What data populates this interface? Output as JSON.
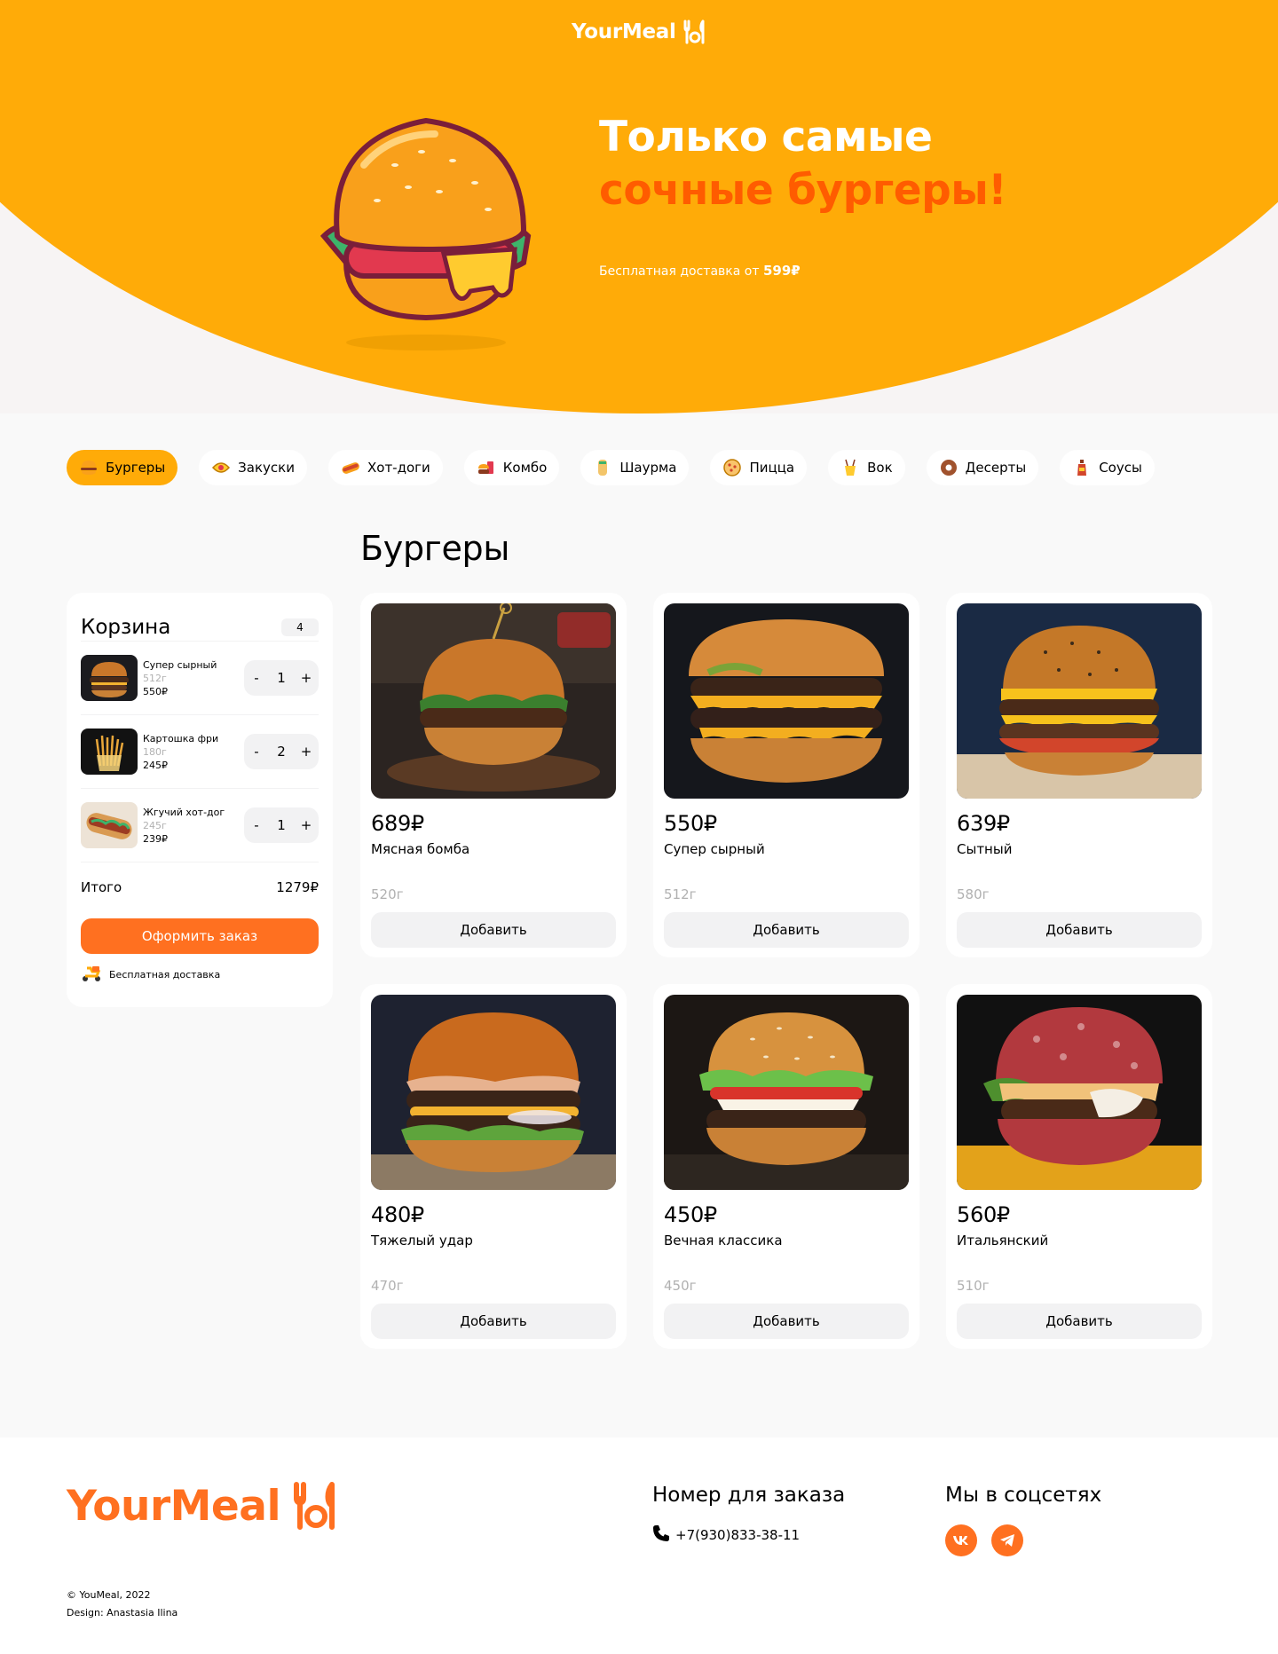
{
  "header": {
    "logo_text": "YourMeal",
    "title_line1": "Только самые",
    "title_line2": "сочные бургеры!",
    "delivery_text": "Бесплатная доставка от ",
    "delivery_amount": "599₽"
  },
  "categories": [
    {
      "label": "Бургеры",
      "icon": "burger-icon",
      "active": true
    },
    {
      "label": "Закуски",
      "icon": "snack-icon"
    },
    {
      "label": "Хот-доги",
      "icon": "hotdog-icon"
    },
    {
      "label": "Комбо",
      "icon": "combo-icon"
    },
    {
      "label": "Шаурма",
      "icon": "shawarma-icon"
    },
    {
      "label": "Пицца",
      "icon": "pizza-icon"
    },
    {
      "label": "Вок",
      "icon": "wok-icon"
    },
    {
      "label": "Десерты",
      "icon": "donut-icon"
    },
    {
      "label": "Соусы",
      "icon": "sauce-icon"
    }
  ],
  "section_title": "Бургеры",
  "cart": {
    "title": "Корзина",
    "count": "4",
    "items": [
      {
        "name": "Супер сырный",
        "weight": "512г",
        "price": "550₽",
        "qty": "1"
      },
      {
        "name": "Картошка фри",
        "weight": "180г",
        "price": "245₽",
        "qty": "2"
      },
      {
        "name": "Жгучий хот-дог",
        "weight": "245г",
        "price": "239₽",
        "qty": "1"
      }
    ],
    "minus": "-",
    "plus": "+",
    "total_label": "Итого",
    "total_value": "1279₽",
    "order_button": "Оформить заказ",
    "free_delivery": "Бесплатная доставка"
  },
  "products": [
    {
      "price": "689₽",
      "name": "Мясная бомба",
      "weight": "520г",
      "button": "Добавить"
    },
    {
      "price": "550₽",
      "name": "Супер сырный",
      "weight": "512г",
      "button": "Добавить"
    },
    {
      "price": "639₽",
      "name": "Сытный",
      "weight": "580г",
      "button": "Добавить"
    },
    {
      "price": "480₽",
      "name": "Тяжелый удар",
      "weight": "470г",
      "button": "Добавить"
    },
    {
      "price": "450₽",
      "name": "Вечная классика",
      "weight": "450г",
      "button": "Добавить"
    },
    {
      "price": "560₽",
      "name": "Итальянский",
      "weight": "510г",
      "button": "Добавить"
    }
  ],
  "footer": {
    "logo_text": "YourMeal",
    "copyright": "© YouMeal, 2022",
    "design": "Design: Anastasia Ilina",
    "order_heading": "Номер для заказа",
    "phone": "+7(930)833-38-11",
    "social_heading": "Мы в соцсетях",
    "social": [
      "vk-icon",
      "telegram-icon"
    ]
  },
  "colors": {
    "primary": "#FFAB08",
    "accent": "#FF7020",
    "hero_accent": "#FF5C00",
    "background": "#F9F9F9"
  }
}
